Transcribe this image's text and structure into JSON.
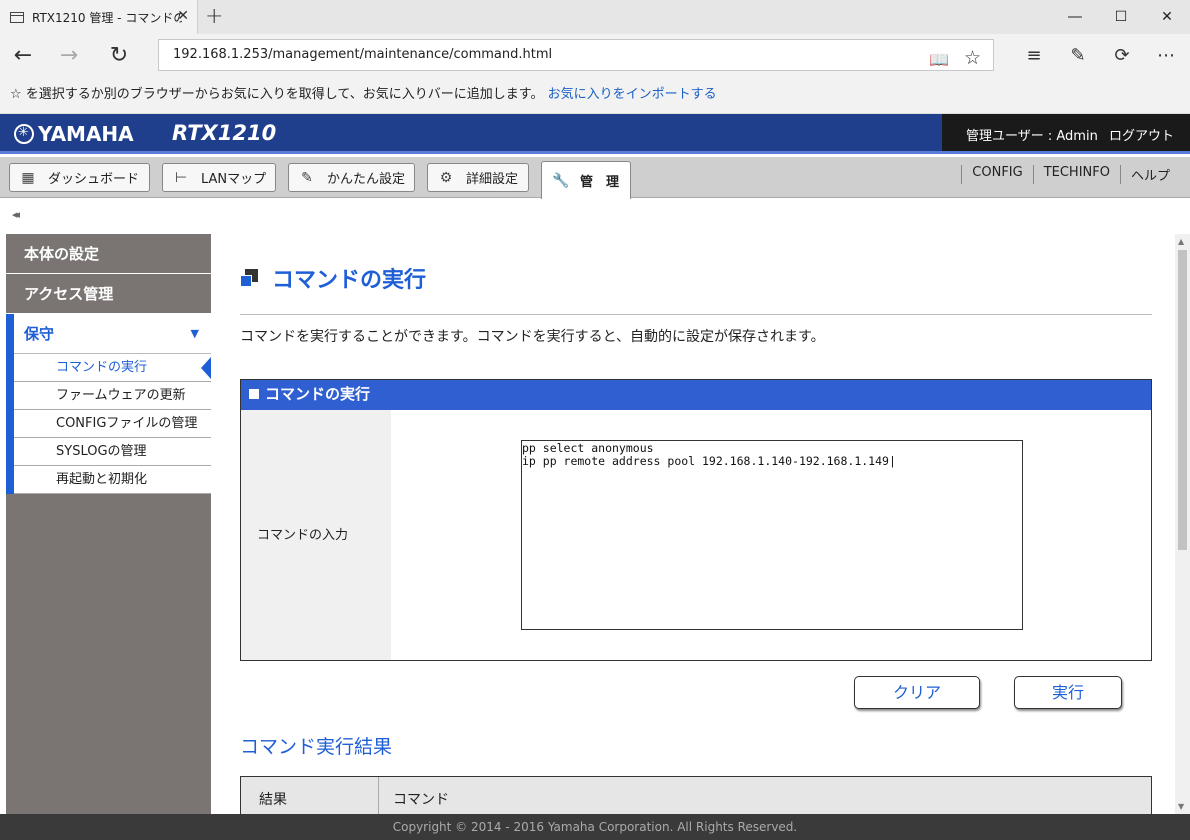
{
  "browser": {
    "tab_title": "RTX1210 管理 - コマンドの",
    "tab_close": "✕",
    "new_tab": "+",
    "url": "192.168.1.253/management/maintenance/command.html",
    "fav_bar_text": "☆ を選択するか別のブラウザーからお気に入りを取得して、お気に入りバーに追加します。",
    "fav_bar_link": "お気に入りをインポートする"
  },
  "header": {
    "brand": "YAMAHA",
    "model": "RTX1210",
    "user": "管理ユーザー : Admin",
    "logout": "ログアウト"
  },
  "tabs": [
    {
      "label": "ダッシュボード",
      "icon": "▦"
    },
    {
      "label": "LANマップ",
      "icon": "⊢"
    },
    {
      "label": "かんたん設定",
      "icon": "✎"
    },
    {
      "label": "詳細設定",
      "icon": "⚙"
    },
    {
      "label": "管　理",
      "icon": "🔧"
    }
  ],
  "top_links": [
    "CONFIG",
    "TECHINFO",
    "ヘルプ"
  ],
  "sidebar": {
    "collapse": "◂◂",
    "heads": [
      "本体の設定",
      "アクセス管理"
    ],
    "group_title": "保守",
    "group_caret": "▼",
    "items": [
      "コマンドの実行",
      "ファームウェアの更新",
      "CONFIGファイルの管理",
      "SYSLOGの管理",
      "再起動と初期化"
    ]
  },
  "main": {
    "title": "コマンドの実行",
    "description": "コマンドを実行することができます。コマンドを実行すると、自動的に設定が保存されます。",
    "box_title": "コマンドの実行",
    "input_label": "コマンドの入力",
    "command_text": "pp select anonymous\nip pp remote address pool 192.168.1.140-192.168.1.149|",
    "clear_button": "クリア",
    "run_button": "実行",
    "result_title": "コマンド実行結果",
    "result_col1": "結果",
    "result_col2": "コマンド"
  },
  "footer": "Copyright © 2014 - 2016 Yamaha Corporation. All Rights Reserved."
}
